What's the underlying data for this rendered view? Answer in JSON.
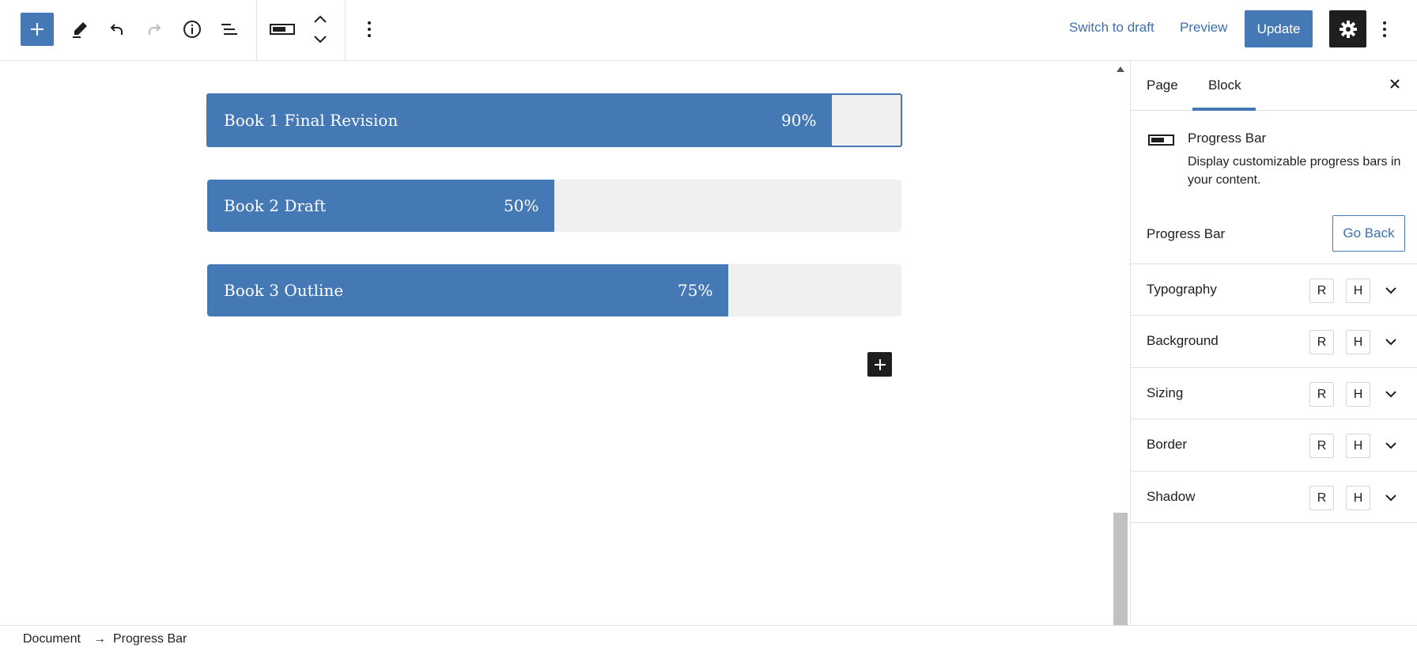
{
  "toolbar": {
    "add_icon": "plus-icon",
    "tools_icon": "pencil-icon",
    "undo_icon": "undo-icon",
    "redo_icon": "redo-icon",
    "info_icon": "info-icon",
    "list_view_icon": "list-view-icon",
    "block_type_icon": "progress-bar-icon",
    "move_icon": "chevron-up-down-icon",
    "more_icon": "kebab-icon",
    "switch_to_draft": "Switch to draft",
    "preview": "Preview",
    "update": "Update",
    "settings_icon": "gear-icon",
    "options_icon": "kebab-icon"
  },
  "progress_bars": [
    {
      "label": "Book 1 Final Revision",
      "percent_text": "90%",
      "percent": 90,
      "selected": true
    },
    {
      "label": "Book 2 Draft",
      "percent_text": "50%",
      "percent": 50,
      "selected": false
    },
    {
      "label": "Book 3 Outline",
      "percent_text": "75%",
      "percent": 75,
      "selected": false
    }
  ],
  "sidebar": {
    "tabs": [
      "Page",
      "Block"
    ],
    "active_tab": "Block",
    "block": {
      "title": "Progress Bar",
      "description": "Display customizable progress bars in your content."
    },
    "variation_label": "Progress Bar",
    "go_back": "Go Back",
    "panels": [
      {
        "title": "Typography",
        "r": "R",
        "h": "H"
      },
      {
        "title": "Background",
        "r": "R",
        "h": "H"
      },
      {
        "title": "Sizing",
        "r": "R",
        "h": "H"
      },
      {
        "title": "Border",
        "r": "R",
        "h": "H"
      },
      {
        "title": "Shadow",
        "r": "R",
        "h": "H"
      }
    ]
  },
  "breadcrumb": {
    "items": [
      "Document",
      "Progress Bar"
    ],
    "separator": "→"
  },
  "colors": {
    "accent": "#4579b5",
    "track": "#f0f0f0",
    "dark": "#1e1e1e"
  }
}
